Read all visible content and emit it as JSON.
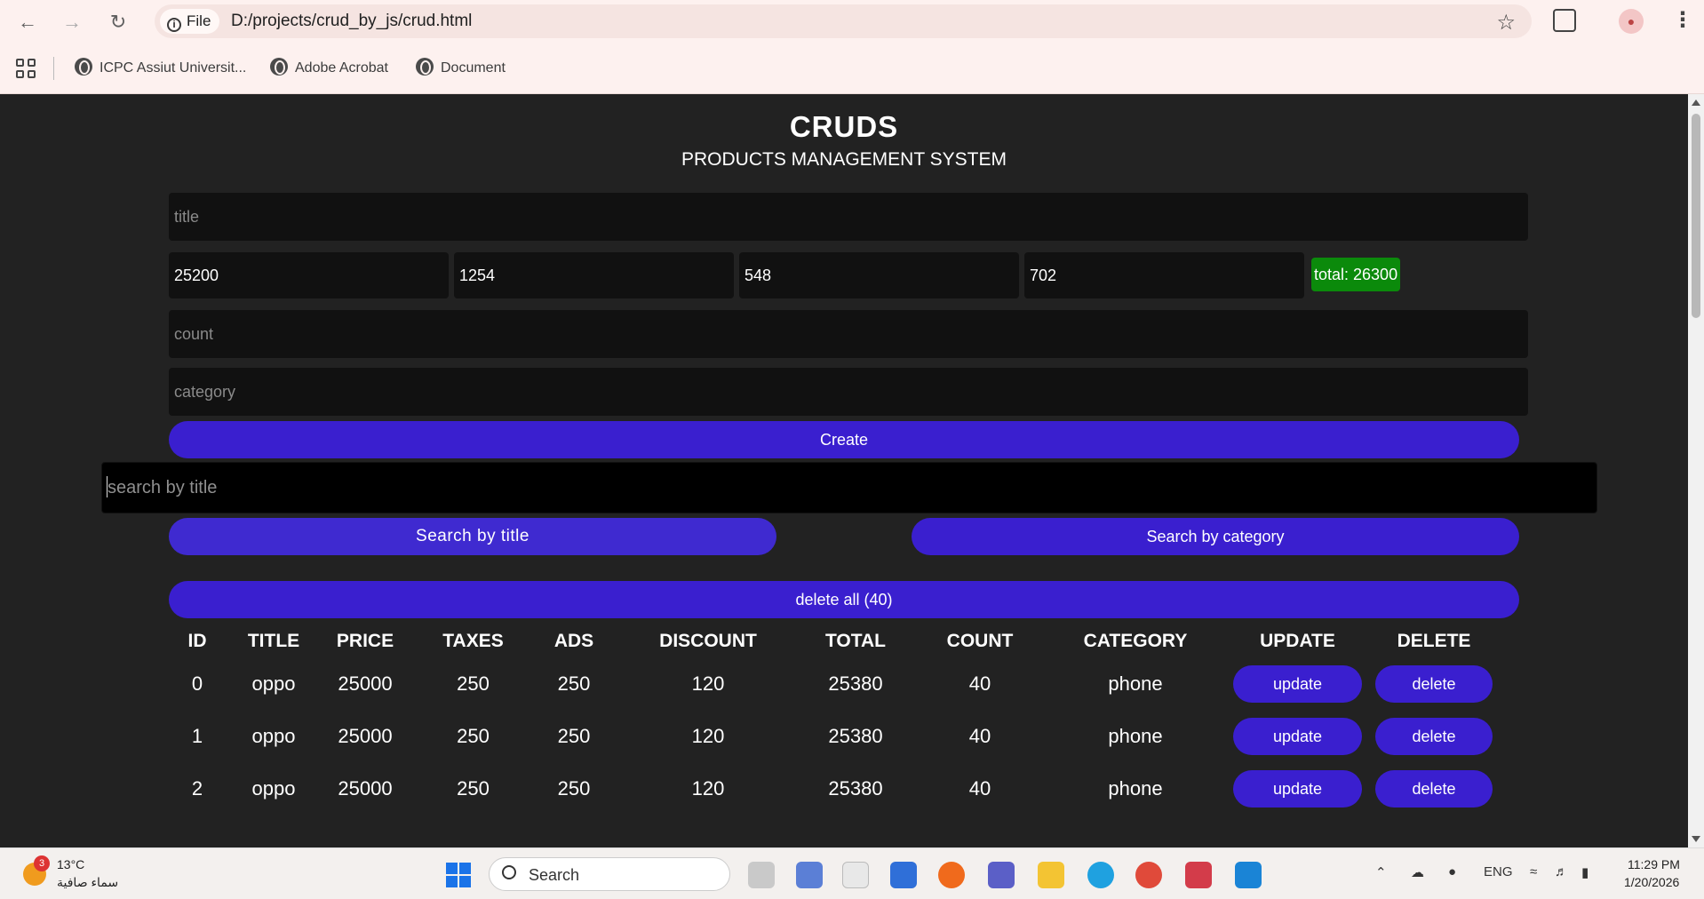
{
  "browser": {
    "address_chip": "File",
    "url": "D:/projects/crud_by_js/crud.html",
    "bookmarks": [
      "ICPC Assiut Universit...",
      "Adobe Acrobat",
      "Document"
    ]
  },
  "page": {
    "title": "CRUDS",
    "subtitle": "PRODUCTS MANAGEMENT SYSTEM"
  },
  "form": {
    "title_placeholder": "title",
    "price_value": "25200",
    "taxes_value": "1254",
    "ads_value": "548",
    "discount_value": "702",
    "total_label": "total: 26300",
    "count_placeholder": "count",
    "category_placeholder": "category",
    "create_label": "Create"
  },
  "search": {
    "placeholder": "search by title",
    "by_title_label": "Search by title",
    "by_category_label": "Search by category",
    "delete_all_label": "delete all (40)"
  },
  "table": {
    "headers": [
      "ID",
      "TITLE",
      "PRICE",
      "TAXES",
      "ADS",
      "DISCOUNT",
      "TOTAL",
      "COUNT",
      "CATEGORY",
      "UPDATE",
      "DELETE"
    ],
    "rows": [
      {
        "id": "0",
        "title": "oppo",
        "price": "25000",
        "taxes": "250",
        "ads": "250",
        "discount": "120",
        "total": "25380",
        "count": "40",
        "category": "phone"
      },
      {
        "id": "1",
        "title": "oppo",
        "price": "25000",
        "taxes": "250",
        "ads": "250",
        "discount": "120",
        "total": "25380",
        "count": "40",
        "category": "phone"
      },
      {
        "id": "2",
        "title": "oppo",
        "price": "25000",
        "taxes": "250",
        "ads": "250",
        "discount": "120",
        "total": "25380",
        "count": "40",
        "category": "phone"
      }
    ],
    "update_label": "update",
    "delete_label": "delete"
  },
  "taskbar": {
    "weather_temp": "13°C",
    "weather_desc": "سماء صافية",
    "weather_badge": "3",
    "search_label": "Search",
    "lang": "ENG",
    "time": "11:29 PM",
    "date": "1/20/2026"
  }
}
